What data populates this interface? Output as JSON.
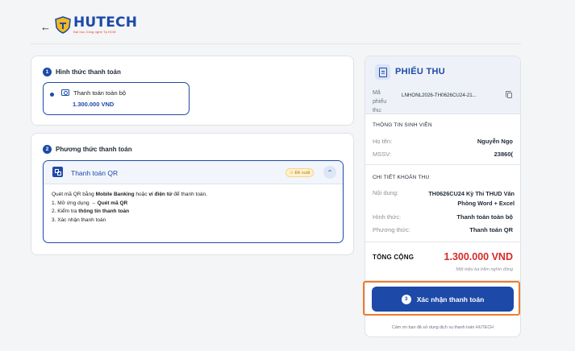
{
  "header": {
    "back_icon": "arrow-left-icon",
    "logo_name": "HUTECH",
    "logo_tagline": "Đại học Công nghệ Tp.HCM"
  },
  "step1": {
    "number": "1",
    "title": "Hình thức thanh toán",
    "option_label": "Thanh toán toàn bộ",
    "option_amount": "1.300.000 VND"
  },
  "step2": {
    "number": "2",
    "title": "Phương thức thanh toán",
    "method_title": "Thanh toán QR",
    "badge": "☆ Đề xuất",
    "collapse_icon": "chevron-up-icon",
    "instructions": {
      "line1_a": "Quét mã QR bằng ",
      "line1_b": "Mobile Banking",
      "line1_c": " hoặc ",
      "line1_d": "ví điện tử",
      "line1_e": " để thanh toán.",
      "line2_a": "1. Mở ứng dụng → ",
      "line2_b": "Quét mã QR",
      "line3_a": "2. Kiểm tra ",
      "line3_b": "thông tin thanh toán",
      "line4": "3. Xác nhận thanh toán"
    }
  },
  "receipt": {
    "title": "PHIẾU THU",
    "code_label": "Mã phiếu thu:",
    "code": "LNHONL2026-TH0626CU24-21...",
    "student_section": "THÔNG TIN SINH VIÊN",
    "name_label": "Họ tên:",
    "name": "Nguyễn Ngọ",
    "id_label": "MSSV:",
    "id": "23860(",
    "fee_section": "CHI TIẾT KHOẢN THU",
    "content_label": "Nội dung:",
    "content": "TH0626CU24 Kỳ Thi THUD Văn Phòng Word + Excel",
    "form_label": "Hình thức:",
    "form": "Thanh toán toàn bộ",
    "method_label": "Phương thức:",
    "method": "Thanh toán QR",
    "total_label": "TỔNG CỘNG",
    "total": "1.300.000 VND",
    "total_words": "Một triệu ba trăm nghìn đồng"
  },
  "confirm": {
    "number": "3",
    "label": "Xác nhận thanh toán"
  },
  "footer": {
    "thanks": "Cảm ơn bạn đã sử dụng dịch vụ thanh toán HUTECH"
  },
  "colors": {
    "primary": "#1d4aa8",
    "total_red": "#d62a2a",
    "highlight_orange": "#ee7c2e",
    "badge_bg": "#fff1cc"
  }
}
